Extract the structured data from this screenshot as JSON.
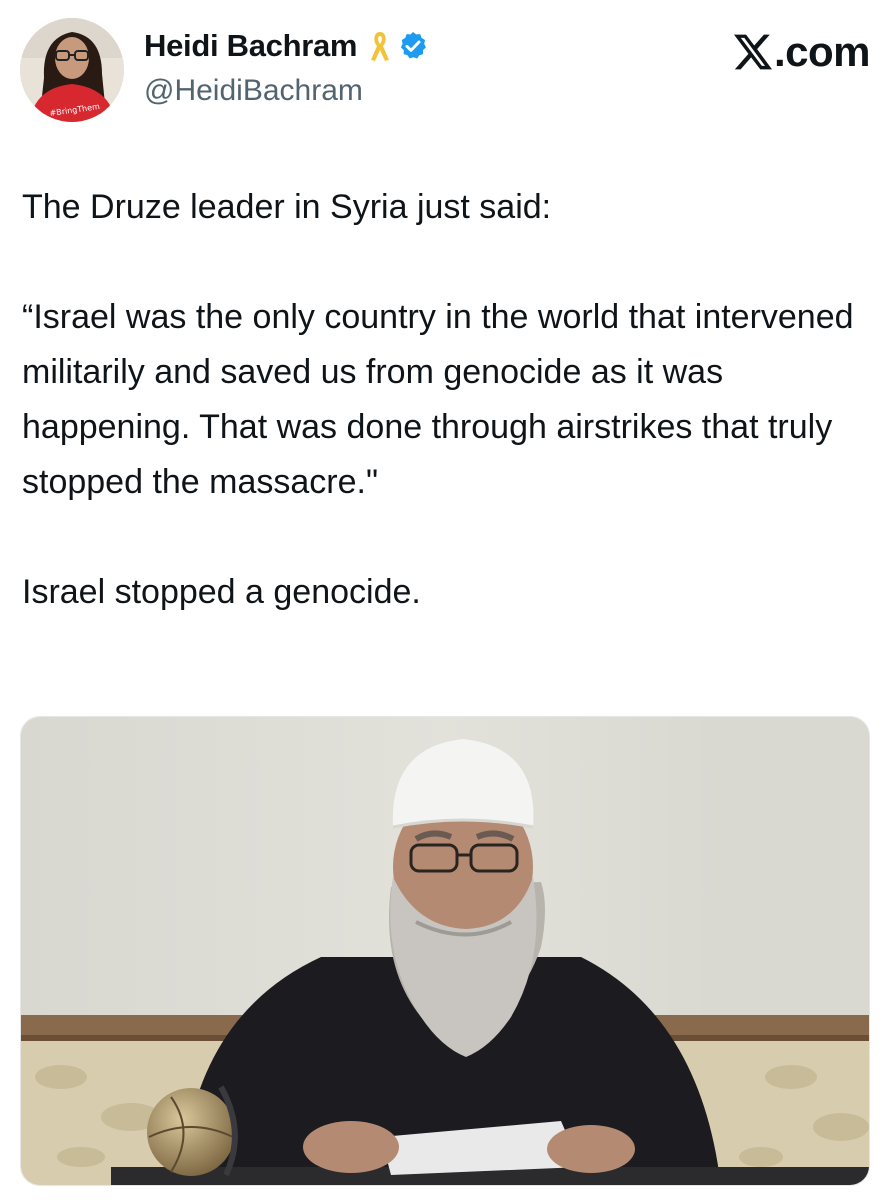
{
  "author": {
    "display_name": "Heidi Bachram",
    "handle": "@HeidiBachram",
    "avatar_icon": "profile-photo",
    "badge_icons": [
      "yellow-ribbon-icon",
      "verified-badge-icon"
    ]
  },
  "brand": {
    "label": ".com",
    "logo_icon": "x-logo-icon"
  },
  "tweet": {
    "paragraphs": [
      "The Druze leader in Syria just said:",
      "“Israel was the only country in the world that intervened militarily and saved us from genocide as it was happening. That was done through airstrikes that truly stopped the massacre.\"",
      "Israel stopped a genocide."
    ]
  },
  "colors": {
    "text": "#0f1419",
    "secondary": "#536471",
    "verified": "#1d9bf0",
    "ribbon": "#f2c33a"
  },
  "media": {
    "type": "photo"
  }
}
